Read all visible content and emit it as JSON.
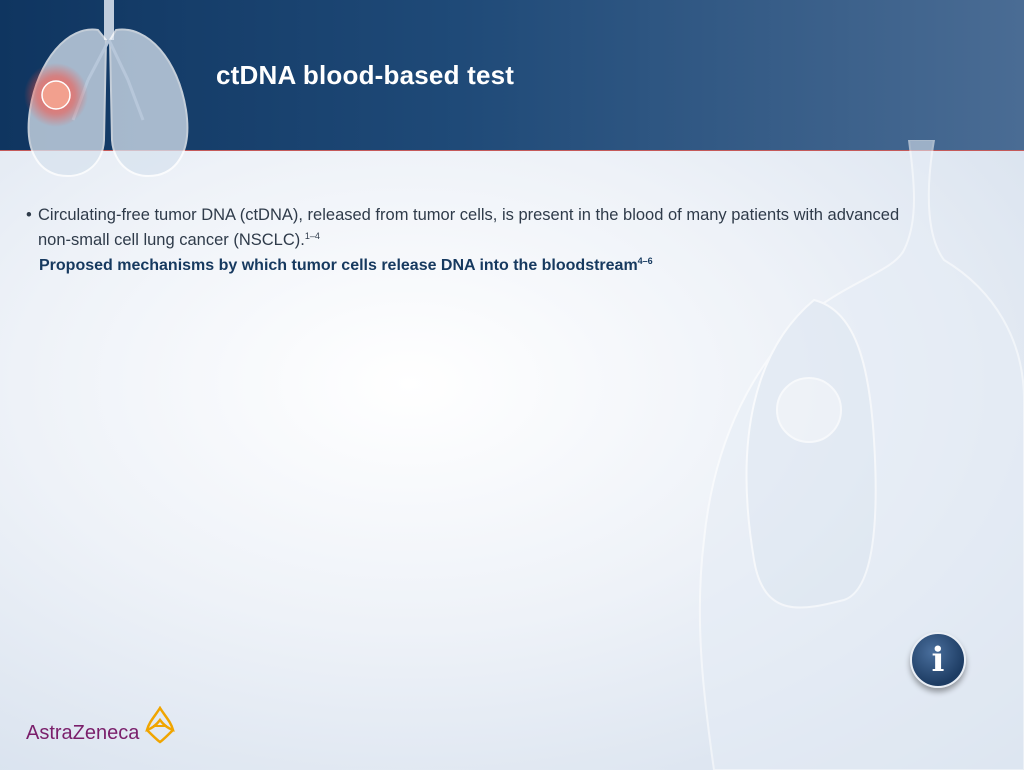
{
  "header": {
    "title": "ctDNA blood-based test",
    "icon": "lungs-illustration-icon"
  },
  "content": {
    "bullet_text": "Circulating-free tumor DNA (ctDNA), released from tumor cells, is present in the blood of many patients with advanced non-small cell lung cancer (NSCLC).",
    "bullet_ref": "1–4",
    "subheading": "Proposed mechanisms by which tumor cells release DNA into the bloodstream",
    "subheading_ref": "4–6"
  },
  "info_button": {
    "label": "i",
    "icon": "info-icon"
  },
  "logo": {
    "text": "AstraZeneca",
    "icon": "astrazeneca-logo-icon"
  },
  "colors": {
    "header_dark": "#0f3560",
    "header_light": "#4a6c94",
    "subheading": "#16395f",
    "logo_purple": "#7a1f6b",
    "logo_gold": "#f0a500",
    "tumor_red": "#e8453c"
  }
}
